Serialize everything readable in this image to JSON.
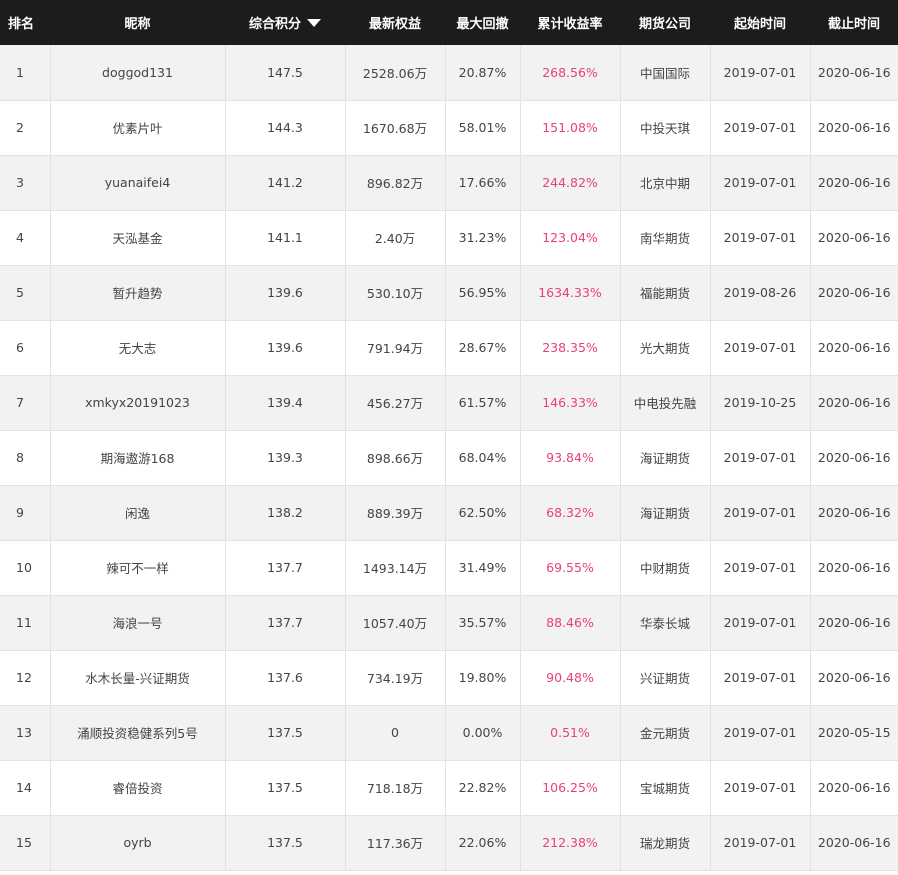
{
  "header": {
    "rank": "排名",
    "nickname": "昵称",
    "score": "综合积分",
    "equity": "最新权益",
    "drawdown": "最大回撤",
    "return_rate": "累计收益率",
    "broker": "期货公司",
    "start": "起始时间",
    "end": "截止时间",
    "sort_icon": "triangle-down-icon"
  },
  "accent_color": "#e8407a",
  "rows": [
    {
      "rank": "1",
      "nickname": "doggod131",
      "score": "147.5",
      "equity": "2528.06万",
      "drawdown": "20.87%",
      "return_rate": "268.56%",
      "broker": "中国国际",
      "start": "2019-07-01",
      "end": "2020-06-16"
    },
    {
      "rank": "2",
      "nickname": "优素片叶",
      "score": "144.3",
      "equity": "1670.68万",
      "drawdown": "58.01%",
      "return_rate": "151.08%",
      "broker": "中投天琪",
      "start": "2019-07-01",
      "end": "2020-06-16"
    },
    {
      "rank": "3",
      "nickname": "yuanaifei4",
      "score": "141.2",
      "equity": "896.82万",
      "drawdown": "17.66%",
      "return_rate": "244.82%",
      "broker": "北京中期",
      "start": "2019-07-01",
      "end": "2020-06-16"
    },
    {
      "rank": "4",
      "nickname": "天泓基金",
      "score": "141.1",
      "equity": "2.40万",
      "drawdown": "31.23%",
      "return_rate": "123.04%",
      "broker": "南华期货",
      "start": "2019-07-01",
      "end": "2020-06-16"
    },
    {
      "rank": "5",
      "nickname": "暂升趋势",
      "score": "139.6",
      "equity": "530.10万",
      "drawdown": "56.95%",
      "return_rate": "1634.33%",
      "broker": "福能期货",
      "start": "2019-08-26",
      "end": "2020-06-16"
    },
    {
      "rank": "6",
      "nickname": "无大志",
      "score": "139.6",
      "equity": "791.94万",
      "drawdown": "28.67%",
      "return_rate": "238.35%",
      "broker": "光大期货",
      "start": "2019-07-01",
      "end": "2020-06-16"
    },
    {
      "rank": "7",
      "nickname": "xmkyx20191023",
      "score": "139.4",
      "equity": "456.27万",
      "drawdown": "61.57%",
      "return_rate": "146.33%",
      "broker": "中电投先融",
      "start": "2019-10-25",
      "end": "2020-06-16"
    },
    {
      "rank": "8",
      "nickname": "期海遨游168",
      "score": "139.3",
      "equity": "898.66万",
      "drawdown": "68.04%",
      "return_rate": "93.84%",
      "broker": "海证期货",
      "start": "2019-07-01",
      "end": "2020-06-16"
    },
    {
      "rank": "9",
      "nickname": "闲逸",
      "score": "138.2",
      "equity": "889.39万",
      "drawdown": "62.50%",
      "return_rate": "68.32%",
      "broker": "海证期货",
      "start": "2019-07-01",
      "end": "2020-06-16"
    },
    {
      "rank": "10",
      "nickname": "辣可不一样",
      "score": "137.7",
      "equity": "1493.14万",
      "drawdown": "31.49%",
      "return_rate": "69.55%",
      "broker": "中财期货",
      "start": "2019-07-01",
      "end": "2020-06-16"
    },
    {
      "rank": "11",
      "nickname": "海浪一号",
      "score": "137.7",
      "equity": "1057.40万",
      "drawdown": "35.57%",
      "return_rate": "88.46%",
      "broker": "华泰长城",
      "start": "2019-07-01",
      "end": "2020-06-16"
    },
    {
      "rank": "12",
      "nickname": "水木长量-兴证期货",
      "score": "137.6",
      "equity": "734.19万",
      "drawdown": "19.80%",
      "return_rate": "90.48%",
      "broker": "兴证期货",
      "start": "2019-07-01",
      "end": "2020-06-16"
    },
    {
      "rank": "13",
      "nickname": "涌顺投资稳健系列5号",
      "score": "137.5",
      "equity": "0",
      "drawdown": "0.00%",
      "return_rate": "0.51%",
      "broker": "金元期货",
      "start": "2019-07-01",
      "end": "2020-05-15"
    },
    {
      "rank": "14",
      "nickname": "睿倍投资",
      "score": "137.5",
      "equity": "718.18万",
      "drawdown": "22.82%",
      "return_rate": "106.25%",
      "broker": "宝城期货",
      "start": "2019-07-01",
      "end": "2020-06-16"
    },
    {
      "rank": "15",
      "nickname": "oyrb",
      "score": "137.5",
      "equity": "117.36万",
      "drawdown": "22.06%",
      "return_rate": "212.38%",
      "broker": "瑞龙期货",
      "start": "2019-07-01",
      "end": "2020-06-16"
    }
  ]
}
